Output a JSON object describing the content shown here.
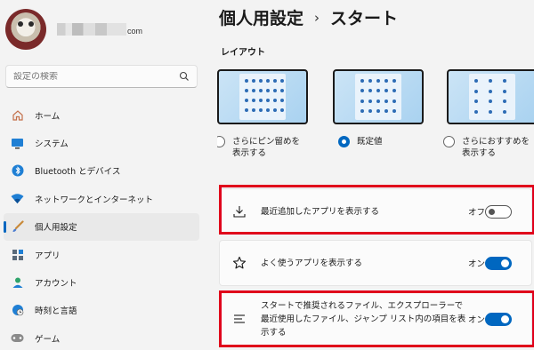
{
  "profile": {
    "email_domain": "com"
  },
  "search": {
    "placeholder": "設定の検索"
  },
  "sidebar": {
    "items": [
      {
        "label": "ホーム",
        "icon": "home-icon"
      },
      {
        "label": "システム",
        "icon": "monitor-icon"
      },
      {
        "label": "Bluetooth とデバイス",
        "icon": "bluetooth-icon"
      },
      {
        "label": "ネットワークとインターネット",
        "icon": "wifi-icon"
      },
      {
        "label": "個人用設定",
        "icon": "brush-icon",
        "active": true
      },
      {
        "label": "アプリ",
        "icon": "apps-icon"
      },
      {
        "label": "アカウント",
        "icon": "person-icon"
      },
      {
        "label": "時刻と言語",
        "icon": "globe-clock-icon"
      },
      {
        "label": "ゲーム",
        "icon": "gamepad-icon"
      }
    ]
  },
  "header": {
    "parent": "個人用設定",
    "separator": "›",
    "current": "スタート"
  },
  "layout_section": {
    "title": "レイアウト",
    "options": [
      {
        "label_line1": "さらにピン留めを",
        "label_line2": "表示する",
        "selected": false
      },
      {
        "label_line1": "既定値",
        "label_line2": "",
        "selected": true
      },
      {
        "label_line1": "さらにおすすめを",
        "label_line2": "表示する",
        "selected": false
      }
    ]
  },
  "settings": [
    {
      "label": "最近追加したアプリを表示する",
      "state": "オフ",
      "on": false,
      "icon": "download-icon",
      "highlighted": true
    },
    {
      "label": "よく使うアプリを表示する",
      "state": "オン",
      "on": true,
      "icon": "star-icon",
      "highlighted": false
    },
    {
      "label": "スタートで推奨されるファイル、エクスプローラーで最近使用したファイル、ジャンプ リスト内の項目を表示する",
      "state": "オン",
      "on": true,
      "icon": "list-icon",
      "highlighted": true
    }
  ],
  "colors": {
    "accent": "#0067c0",
    "highlight": "#e0001b"
  }
}
